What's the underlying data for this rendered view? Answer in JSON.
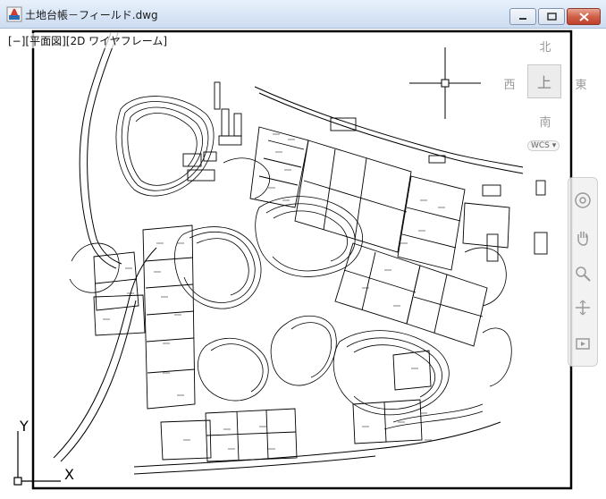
{
  "window": {
    "title": "土地台帳－フィールド.dwg",
    "icon": "autocad-dwg-icon",
    "controls": [
      "minimize-icon",
      "maximize-icon",
      "close-icon"
    ]
  },
  "viewport": {
    "label": "[−][平面図][2D ワイヤフレーム]"
  },
  "viewcube": {
    "north": "北",
    "south": "南",
    "east": "東",
    "west": "西",
    "face": "上",
    "wcs": "WCS ▾"
  },
  "ucs": {
    "x_label": "X",
    "y_label": "Y"
  },
  "navbar": {
    "tools": [
      "steering-wheel-icon",
      "pan-hand-icon",
      "zoom-icon",
      "orbit-icon",
      "showmotion-icon"
    ]
  },
  "colors": {
    "titlebar": "#d6e4f5",
    "close_button": "#c9503a",
    "drawing_lines": "#000000",
    "canvas": "#ffffff"
  }
}
